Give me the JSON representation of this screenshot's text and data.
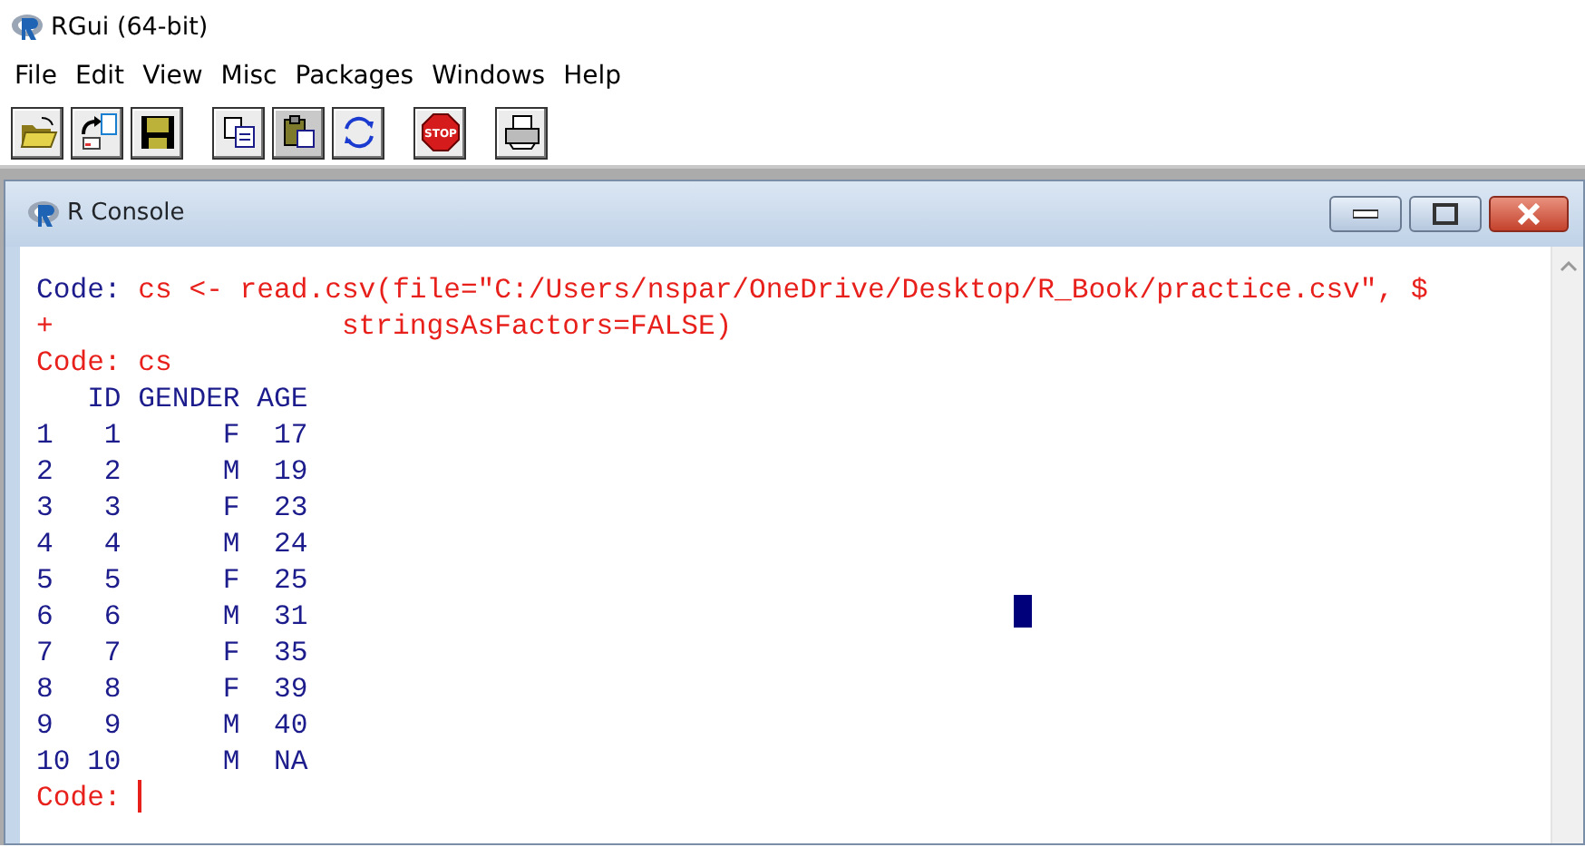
{
  "window": {
    "title": "RGui (64-bit)"
  },
  "toolbar": {
    "stop_label": "STOP"
  },
  "menu": [
    "File",
    "Edit",
    "View",
    "Misc",
    "Packages",
    "Windows",
    "Help"
  ],
  "console": {
    "title": "R Console",
    "lines": [
      [
        {
          "kind": "prompt",
          "text": "Code: "
        },
        {
          "kind": "input",
          "text": "cs <- read.csv(file=\"C:/Users/nspar/OneDrive/Desktop/R_Book/practice.csv\", $"
        }
      ],
      [
        {
          "kind": "input",
          "text": "+                 stringsAsFactors=FALSE)"
        }
      ],
      [
        {
          "kind": "input",
          "text": "Code: cs"
        }
      ],
      [
        {
          "kind": "output",
          "text": "   ID GENDER AGE"
        }
      ],
      [
        {
          "kind": "output",
          "text": "1   1      F  17"
        }
      ],
      [
        {
          "kind": "output",
          "text": "2   2      M  19"
        }
      ],
      [
        {
          "kind": "output",
          "text": "3   3      F  23"
        }
      ],
      [
        {
          "kind": "output",
          "text": "4   4      M  24"
        }
      ],
      [
        {
          "kind": "output",
          "text": "5   5      F  25"
        }
      ],
      [
        {
          "kind": "output",
          "text": "6   6      M  31"
        }
      ],
      [
        {
          "kind": "output",
          "text": "7   7      F  35"
        }
      ],
      [
        {
          "kind": "output",
          "text": "8   8      F  39"
        }
      ],
      [
        {
          "kind": "output",
          "text": "9   9      M  40"
        }
      ],
      [
        {
          "kind": "output",
          "text": "10 10      M  NA"
        }
      ],
      [
        {
          "kind": "input",
          "text": "Code: "
        }
      ]
    ]
  }
}
